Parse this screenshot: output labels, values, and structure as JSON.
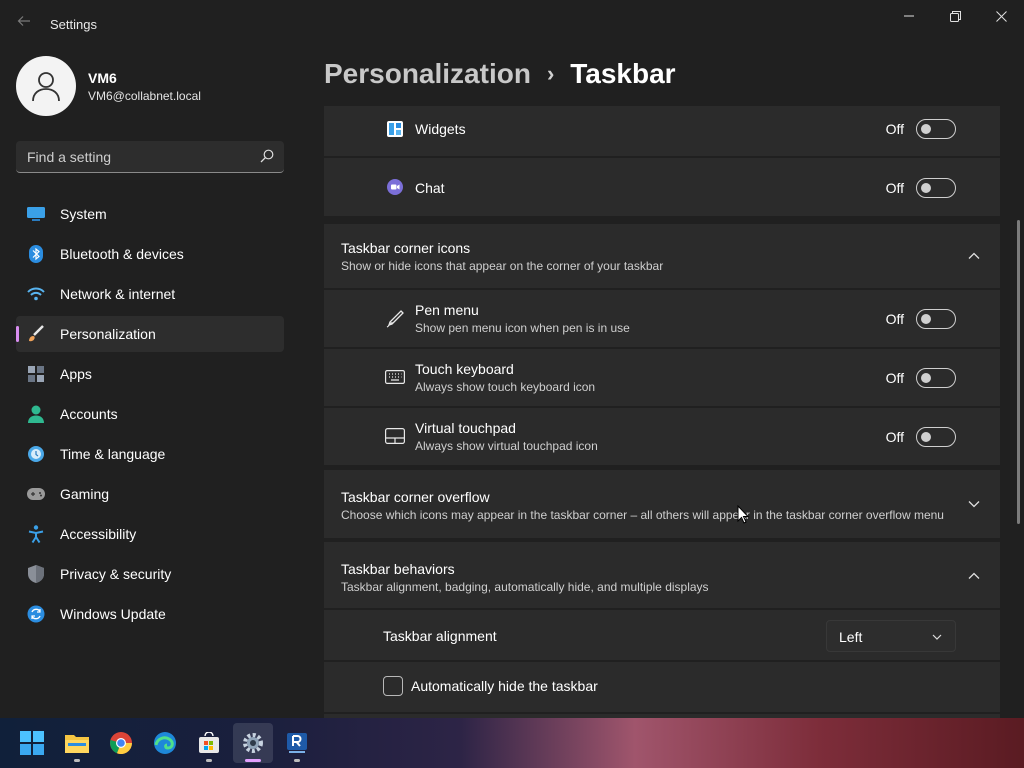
{
  "window": {
    "title": "Settings",
    "controls": {
      "minimize": "minimize-icon",
      "maximize": "restore-icon",
      "close": "close-icon"
    }
  },
  "profile": {
    "name": "VM6",
    "email": "VM6@collabnet.local"
  },
  "search": {
    "placeholder": "Find a setting"
  },
  "sidebar": {
    "items": [
      {
        "label": "System",
        "icon": "monitor-icon",
        "color": "#3aa0e8"
      },
      {
        "label": "Bluetooth & devices",
        "icon": "bluetooth-icon",
        "color": "#2b8de0"
      },
      {
        "label": "Network & internet",
        "icon": "wifi-icon",
        "color": "#58b4f0"
      },
      {
        "label": "Personalization",
        "icon": "paintbrush-icon",
        "color": "#f0a35a",
        "active": true
      },
      {
        "label": "Apps",
        "icon": "apps-icon",
        "color": "#9aa5b5"
      },
      {
        "label": "Accounts",
        "icon": "person-icon",
        "color": "#2fb990"
      },
      {
        "label": "Time & language",
        "icon": "clock-globe-icon",
        "color": "#4aa8e8"
      },
      {
        "label": "Gaming",
        "icon": "gamepad-icon",
        "color": "#9a9a9a"
      },
      {
        "label": "Accessibility",
        "icon": "accessibility-icon",
        "color": "#3aa0e8"
      },
      {
        "label": "Privacy & security",
        "icon": "shield-icon",
        "color": "#8a8f98"
      },
      {
        "label": "Windows Update",
        "icon": "update-icon",
        "color": "#2b8de0"
      }
    ]
  },
  "breadcrumb": {
    "parent": "Personalization",
    "separator": "›",
    "current": "Taskbar"
  },
  "main": {
    "widgets": {
      "label": "Widgets",
      "state": "Off",
      "icon": "widgets-icon"
    },
    "chat": {
      "label": "Chat",
      "state": "Off",
      "icon": "chat-icon"
    },
    "corner_icons": {
      "title": "Taskbar corner icons",
      "subtitle": "Show or hide icons that appear on the corner of your taskbar",
      "items": [
        {
          "label": "Pen menu",
          "sub": "Show pen menu icon when pen is in use",
          "state": "Off",
          "icon": "pen-icon"
        },
        {
          "label": "Touch keyboard",
          "sub": "Always show touch keyboard icon",
          "state": "Off",
          "icon": "keyboard-icon"
        },
        {
          "label": "Virtual touchpad",
          "sub": "Always show virtual touchpad icon",
          "state": "Off",
          "icon": "touchpad-icon"
        }
      ]
    },
    "corner_overflow": {
      "title": "Taskbar corner overflow",
      "subtitle": "Choose which icons may appear in the taskbar corner – all others will appear in the taskbar corner overflow menu"
    },
    "behaviors": {
      "title": "Taskbar behaviors",
      "subtitle": "Taskbar alignment, badging, automatically hide, and multiple displays",
      "alignment_label": "Taskbar alignment",
      "alignment_value": "Left",
      "autohide_label": "Automatically hide the taskbar"
    }
  },
  "taskbar": {
    "apps": [
      "start-icon",
      "file-explorer-icon",
      "chrome-icon",
      "edge-icon",
      "store-icon",
      "settings-icon",
      "remote-app-icon"
    ],
    "active_app": "settings-icon"
  }
}
